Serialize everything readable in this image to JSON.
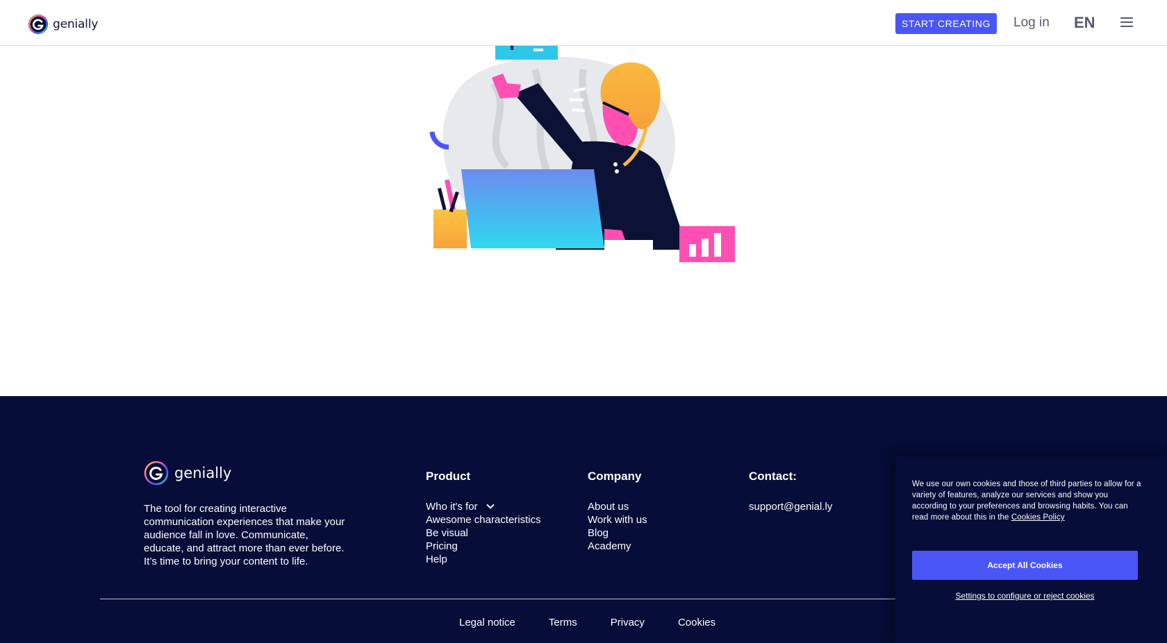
{
  "header": {
    "logo_text": "genially",
    "start_creating": "START CREATING",
    "login": "Log in",
    "language": "EN",
    "menu_icon": "hamburger-menu-icon"
  },
  "footer": {
    "logo_text": "genially",
    "description": "The tool for creating interactive communication experiences that make your audience fall in love. Communicate, educate, and attract more than ever before. It’s time to bring your content to life.",
    "product": {
      "heading": "Product",
      "items": [
        "Who it's for",
        "Awesome characteristics",
        "Be visual",
        "Pricing",
        "Help"
      ]
    },
    "company": {
      "heading": "Company",
      "items": [
        "About us",
        "Work with us",
        "Blog",
        "Academy"
      ]
    },
    "contact": {
      "heading": "Contact:",
      "email": "support@genial.ly"
    },
    "bottom_links": [
      "Legal notice",
      "Terms",
      "Privacy",
      "Cookies"
    ]
  },
  "cookie_banner": {
    "text": "We use our own cookies and those of third parties to allow for a variety of features, analyze our services and show you according to your preferences and browsing habits. You can read more about this in the",
    "policy_link": "Cookies Policy",
    "accept": "Accept All Cookies",
    "settings": "Settings to configure or reject cookies"
  },
  "colors": {
    "brand_blue": "#4a55f6",
    "footer_bg": "#050d38",
    "text_gray": "#555a6e"
  }
}
